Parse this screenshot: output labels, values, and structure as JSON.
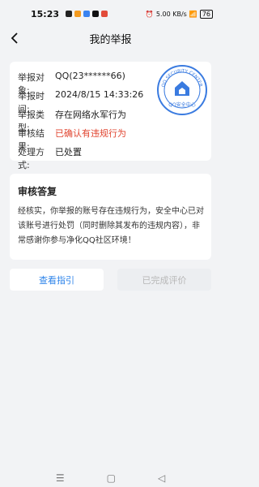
{
  "status_bar": {
    "time": "15:23",
    "network": "5.00 KB/s",
    "battery": "76"
  },
  "nav": {
    "title": "我的举报"
  },
  "report": {
    "rows": [
      {
        "label": "举报对象:",
        "value": "QQ(23******66)"
      },
      {
        "label": "举报时间:",
        "value": "2024/8/15 14:33:26"
      },
      {
        "label": "举报类型:",
        "value": "存在网络水军行为"
      },
      {
        "label": "审核结果:",
        "value": "已确认有违规行为"
      },
      {
        "label": "处理方式:",
        "value": "已处置"
      }
    ],
    "seal_text": "QQ SECURITY CENTER",
    "seal_text_cn": "QQ安全中心",
    "accent_color": "#e0442f"
  },
  "reply": {
    "title": "审核答复",
    "text": "经核实，你举报的账号存在违规行为，安全中心已对该账号进行处罚（同时删除其发布的违规内容），非常感谢你参与净化QQ社区环境！"
  },
  "buttons": {
    "guide": "查看指引",
    "rated": "已完成评价"
  },
  "colors": {
    "primary": "#2e84ea",
    "stamp": "#3a7be0"
  }
}
